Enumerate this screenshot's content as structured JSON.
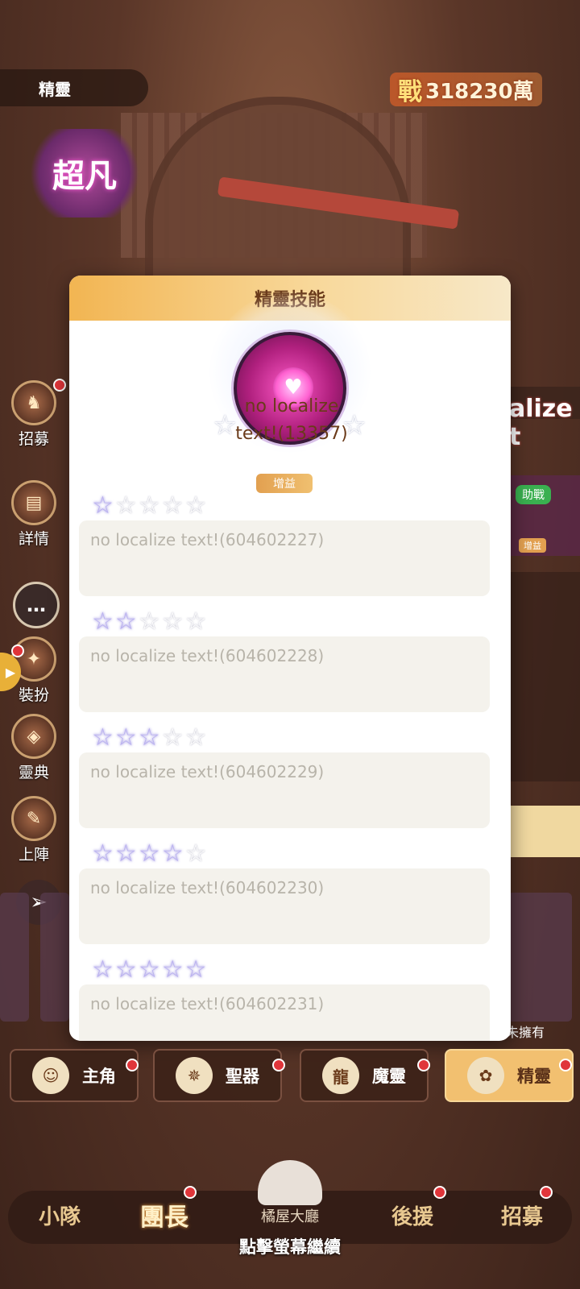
{
  "header": {
    "section_title": "精靈",
    "power_prefix": "戰",
    "power_value": "318230萬",
    "logo_text": "超凡"
  },
  "side_menu": [
    {
      "label": "招募",
      "icon": "recruit-icon"
    },
    {
      "label": "詳情",
      "icon": "book-icon"
    },
    {
      "label": "裝扮",
      "icon": "costume-icon"
    },
    {
      "label": "靈典",
      "icon": "codex-icon"
    },
    {
      "label": "上陣",
      "icon": "deploy-icon"
    }
  ],
  "chat_icon": "…",
  "right_fragment": {
    "text": "alize t",
    "assist_tag": "助戰",
    "buff_tag": "增益",
    "not_owned": "未擁有"
  },
  "modal": {
    "title": "精靈技能",
    "skill_name": "no localize text!(13357)",
    "buff_tag": "增益",
    "levels": [
      {
        "stars": 1,
        "desc": "no localize text!(604602227)"
      },
      {
        "stars": 2,
        "desc": "no localize text!(604602228)"
      },
      {
        "stars": 3,
        "desc": "no localize text!(604602229)"
      },
      {
        "stars": 4,
        "desc": "no localize text!(604602230)"
      },
      {
        "stars": 5,
        "desc": "no localize text!(604602231)"
      }
    ]
  },
  "bottom_tabs": [
    {
      "label": "主角",
      "icon": "hero-icon",
      "active": false
    },
    {
      "label": "聖器",
      "icon": "artifact-icon",
      "active": false
    },
    {
      "label": "魔靈",
      "icon": "dragon-icon",
      "active": false
    },
    {
      "label": "精靈",
      "icon": "sprite-icon",
      "active": true
    }
  ],
  "nav": {
    "items": [
      "小隊",
      "團長",
      "後援",
      "招募"
    ],
    "active": "團長",
    "home_label": "橘屋大廳"
  },
  "continue_hint": "點擊螢幕繼續",
  "colors": {
    "accent": "#f2b552",
    "badge": "#e0353a",
    "star_on": "#b9b0f0"
  }
}
